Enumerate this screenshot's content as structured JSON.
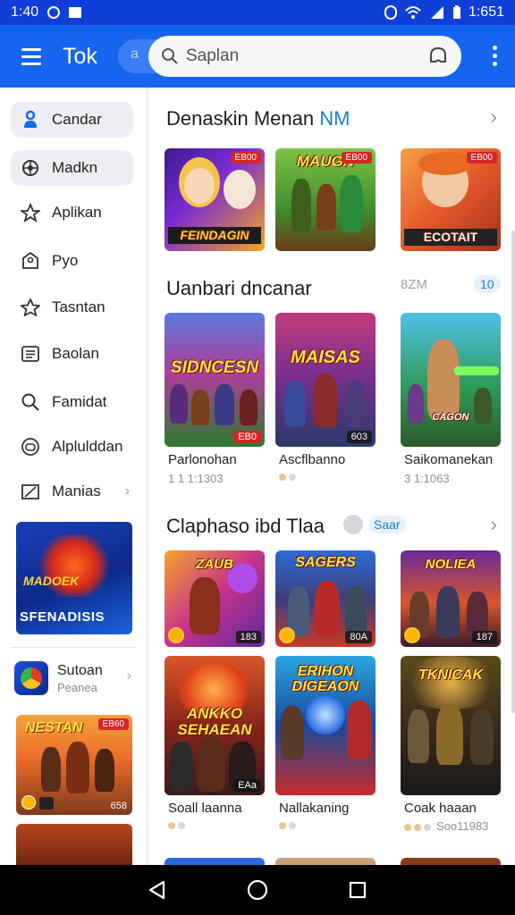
{
  "status_bar": {
    "time": "1:40",
    "clock_right": "1:651"
  },
  "app_bar": {
    "title": "Tok",
    "search_placeholder": "Saplan",
    "search_ghost": "a"
  },
  "sidebar": {
    "items": [
      {
        "label": "Candar",
        "icon": "person-icon",
        "active": true
      },
      {
        "label": "Madkn",
        "icon": "gamepad-icon",
        "active": true
      },
      {
        "label": "Aplikan",
        "icon": "star-person-icon",
        "active": false
      },
      {
        "label": "Pyo",
        "icon": "tag-icon",
        "active": false
      },
      {
        "label": "Tasntan",
        "icon": "star-icon",
        "active": false
      },
      {
        "label": "Baolan",
        "icon": "list-icon",
        "active": false
      },
      {
        "label": "Famidat",
        "icon": "search-icon",
        "active": false
      },
      {
        "label": "Alplulddan",
        "icon": "controller-icon",
        "active": false
      },
      {
        "label": "Manias",
        "icon": "edit-icon",
        "active": false
      }
    ],
    "promo": {
      "title_top": "MADOEK",
      "title_bottom": "SFENADISIS"
    },
    "app": {
      "name": "Sutoan",
      "subtitle": "Peanea"
    },
    "game": {
      "title": "NESTAN",
      "tag": "EB60",
      "count": "658"
    }
  },
  "sections": [
    {
      "title": "Denaskin Menan ",
      "title_highlight": "NM",
      "cards": [
        {
          "art_title": "FEINDAGIN",
          "tag": "EB00",
          "bg": "purple"
        },
        {
          "art_title": "MAUGN",
          "tag": "EB00",
          "bg": "green"
        },
        {
          "art_title": "ECOTAIT",
          "tag": "EB00",
          "bg": "orange"
        }
      ]
    },
    {
      "title": "Uanbari dncanar",
      "meta": "8ZM",
      "badge": "10",
      "cards": [
        {
          "art_title": "SIDNCESN",
          "badge": "EB0",
          "name": "Parlonohan",
          "meta": "1 1 1:1303"
        },
        {
          "art_title": "MAISAS",
          "badge": "603",
          "name": "Ascflbanno",
          "meta": ""
        },
        {
          "art_title": "CAGON",
          "badge": "",
          "name": "Saikomanekan",
          "meta": "3 1:1063"
        }
      ]
    },
    {
      "title": "Claphaso ibd Tlaa",
      "badge": "Saar",
      "cards_row1": [
        {
          "art_title": "ZAUB",
          "badge": "183",
          "coin": true
        },
        {
          "art_title": "SAGERS",
          "badge": "80A",
          "coin": true
        },
        {
          "art_title": "NOLIEA",
          "badge": "187",
          "coin": true
        }
      ],
      "cards_row2": [
        {
          "art_title": "ANKKO SEHAEAN",
          "badge": "EAa",
          "name": "Soall laanna",
          "meta": ""
        },
        {
          "art_title": "ERIHON DIGEAON",
          "badge": "",
          "name": "Nallakaning",
          "meta": ""
        },
        {
          "art_title": "TKNICAK",
          "badge": "",
          "name": "Coak haaan",
          "meta": "Soo11983"
        }
      ]
    }
  ]
}
